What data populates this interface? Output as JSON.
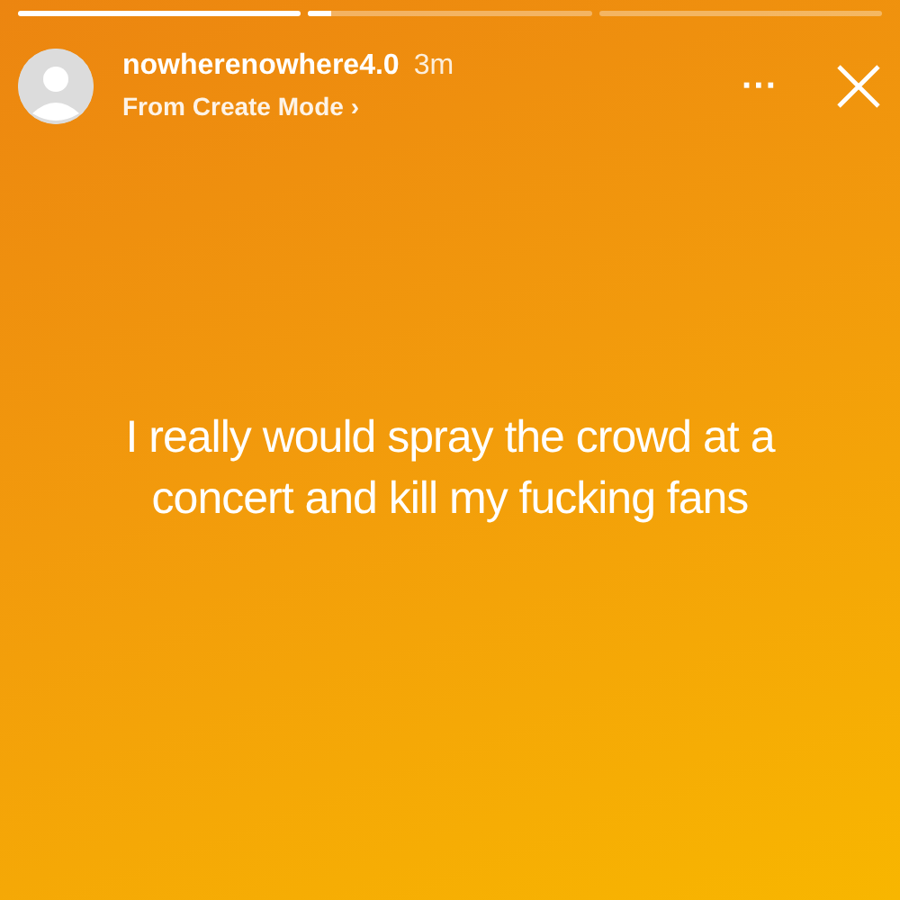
{
  "progress": [
    {
      "level": 1
    },
    {
      "level": 0.08
    },
    {
      "level": 0
    }
  ],
  "header": {
    "username": "nowherenowhere4.0",
    "time": "3m",
    "subtitle": "From Create Mode",
    "subtitle_arrow": "›",
    "more": "···"
  },
  "story_text": "I really would spray the crowd at a concert and kill my fucking fans"
}
